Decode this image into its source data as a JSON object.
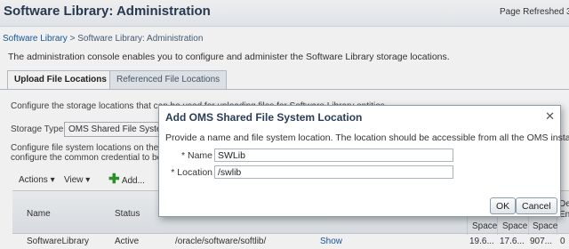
{
  "header": {
    "title": "Software Library: Administration",
    "refreshed": "Page Refreshed 3:"
  },
  "breadcrumb": {
    "root": "Software Library",
    "separator": " > ",
    "current": "Software Library: Administration"
  },
  "intro": "The administration console enables you to configure and administer the Software Library storage locations.",
  "tabs": [
    "Upload File Locations",
    "Referenced File Locations"
  ],
  "background": {
    "configure_text": "Configure the storage locations that can be used for uploading files for Software Library entities.",
    "storage_type_label": "Storage Type",
    "storage_type_value": "OMS Shared File System",
    "config_line1": "Configure file system locations on the O",
    "config_line2": "configure the common credential to be"
  },
  "toolbar": {
    "actions": "Actions ▾",
    "view": "View ▾",
    "add": "Add..."
  },
  "table": {
    "headers": [
      "Name",
      "Status"
    ],
    "right_headers": [
      "Space",
      "Space",
      "Space"
    ],
    "edge_header": [
      "De",
      "En"
    ],
    "row": {
      "name": "SoftwareLibrary",
      "status": "Active",
      "location": "/oracle/software/softlib/",
      "action": "Show",
      "v1": "19.6...",
      "v2": "17.6...",
      "v3": "907...",
      "v4": "0"
    }
  },
  "dialog": {
    "title": "Add OMS Shared File System Location",
    "close": "✕",
    "description": "Provide a name and file system location. The location should be accessible from all the OMS instances.",
    "name_label": "* Name",
    "name_value": "SWLib",
    "location_label": "* Location",
    "location_value": "/swlib",
    "ok": "OK",
    "cancel": "Cancel"
  }
}
